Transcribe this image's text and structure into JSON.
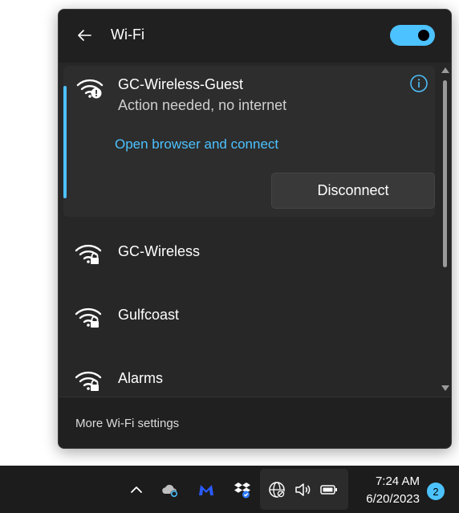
{
  "flyout": {
    "title": "Wi-Fi",
    "wifi_toggle_on": true,
    "accent_color": "#4cc2ff",
    "footer_link": "More Wi-Fi settings"
  },
  "connected_network": {
    "name": "GC-Wireless-Guest",
    "status": "Action needed, no internet",
    "action_link": "Open browser and connect",
    "disconnect_label": "Disconnect",
    "icon": "wifi-warning-icon"
  },
  "networks": [
    {
      "name": "GC-Wireless",
      "icon": "wifi-secured-icon"
    },
    {
      "name": "Gulfcoast",
      "icon": "wifi-secured-icon"
    },
    {
      "name": "Alarms",
      "icon": "wifi-secured-icon"
    }
  ],
  "taskbar": {
    "time": "7:24 AM",
    "date": "6/20/2023",
    "notification_count": "2",
    "tray_icons": [
      "chevron-up-icon",
      "onedrive-icon",
      "malwarebytes-icon",
      "dropbox-icon",
      "network-icon",
      "volume-icon",
      "battery-icon"
    ]
  }
}
